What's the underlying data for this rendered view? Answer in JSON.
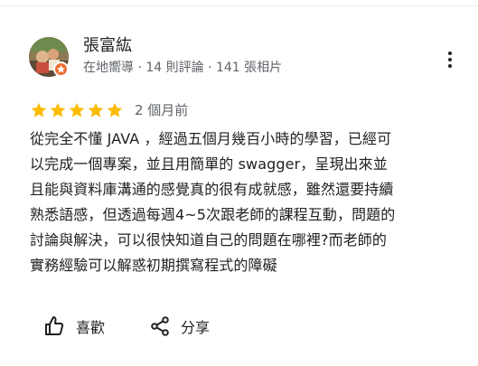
{
  "reviewer": {
    "name": "張富紘",
    "meta": "在地嚮導 · 14 則評論 · 141 張相片"
  },
  "review": {
    "rating": 5,
    "max_rating": 5,
    "time": "2 個月前",
    "text_lines": [
      "從完全不懂 JAVA ，經過五個月幾百小時的學習，已經可",
      "以完成一個專案，並且用簡單的 swagger，呈現出來並",
      "且能與資料庫溝通的感覺真的很有成就感，雖然還要持續",
      "熟悉語感，但透過每週4~5次跟老師的課程互動，問題的",
      "討論與解決，可以很快知道自己的問題在哪裡?而老師的",
      "實務經驗可以解惑初期撰寫程式的障礙"
    ]
  },
  "actions": {
    "like_label": "喜歡",
    "share_label": "分享"
  },
  "icons": {
    "avatar": "avatar",
    "guide_badge": "local-guide-star-icon",
    "more": "more-vert-icon",
    "star": "star-icon",
    "like": "thumb-up-icon",
    "share": "share-icon"
  },
  "colors": {
    "star": "#fbbc04",
    "badge": "#ef6c2f",
    "text": "#202124",
    "secondary_text": "#5f6368"
  }
}
